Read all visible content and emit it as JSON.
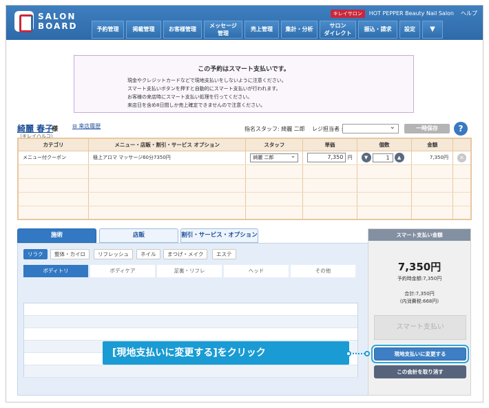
{
  "header": {
    "logo_text": "SALON\nBOARD",
    "badge": "キレイサロン",
    "salon_name": "HOT PEPPER Beauty Nail Salon",
    "help": "ヘルプ",
    "nav": [
      "予約管理",
      "掲載管理",
      "お客様管理",
      "メッセージ\n管理",
      "売上管理",
      "集計・分析",
      "サロン\nダイレクト",
      "振込・請求",
      "設定"
    ],
    "more_icon": "▼"
  },
  "notice": {
    "title": "この予約はスマート支払いです。",
    "lines": [
      "現金やクレジットカードなどで現地支払いをしないように注意ください。",
      "スマート支払いボタンを押すと自動的にスマート支払いが行われます。",
      "お客様の来店時にスマート支払い処理を行ってください。",
      "来店日を含め8日間しか売上確定できませんので注意ください。"
    ]
  },
  "customer": {
    "name": "綺麗 春子",
    "honorific": "様",
    "kana": "（キレイハルコ）",
    "visit_history": "来店履歴",
    "visit_icon": "⊟",
    "staff_info": "指名スタッフ: 綺麗 二郎",
    "register_label": "レジ担当者 :",
    "register_value": "",
    "hold_button": "一時保存",
    "help_icon": "?"
  },
  "table": {
    "headers": [
      "カテゴリ",
      "メニュー・店販・割引・サービス オプション",
      "スタッフ",
      "単価",
      "個数",
      "金額",
      ""
    ],
    "rows": [
      {
        "category": "メニュー付クーポン",
        "menu": "極上アロマ マッサージ60分7350円",
        "staff": "綺麗 二郎",
        "price": "7,350",
        "yen": "円",
        "qty": "1",
        "amount": "7,350円"
      }
    ]
  },
  "tabs": {
    "main": [
      "施術",
      "店販",
      "割引・サービス・オプション"
    ],
    "sub": [
      "リラク",
      "整体・カイロ",
      "リフレッシュ",
      "ネイル",
      "まつげ・メイク",
      "エステ"
    ],
    "categories": [
      "ボディトリ",
      "ボディケア",
      "足裏・リフレ",
      "ヘッド",
      "その他"
    ]
  },
  "payment": {
    "header": "スマート支払い金額",
    "amount": "7,350円",
    "reserved": "予約時金額:7,350円",
    "total": "合計:7,350円",
    "tax": "(内消費税:668円)",
    "smart_pay_button": "スマート支払い",
    "onsite_button": "現地支払いに変更する",
    "cancel_button": "この会計を取り消す"
  },
  "callout": {
    "text": "[現地支払いに変更する]をクリック"
  },
  "colors": {
    "header_blue": "#2d6aa9",
    "accent_blue": "#3278c3",
    "callout_blue": "#1a9bd3",
    "table_border": "#e8c7a0"
  }
}
